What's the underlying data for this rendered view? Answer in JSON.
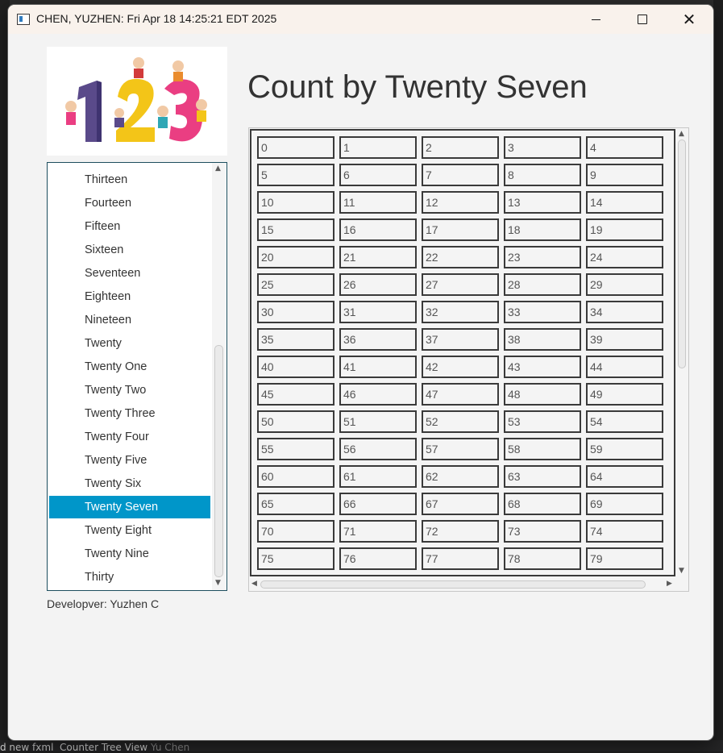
{
  "window": {
    "title": "CHEN, YUZHEN: Fri Apr 18 14:25:21 EDT 2025",
    "controls": {
      "minimize": "–",
      "maximize": "□",
      "close": "✕"
    }
  },
  "heading": "Count by Twenty Seven",
  "developer_label": "Developver: Yuzhen C",
  "list": {
    "items": [
      "Thirteen",
      "Fourteen",
      "Fifteen",
      "Sixteen",
      "Seventeen",
      "Eighteen",
      "Nineteen",
      "Twenty",
      "Twenty One",
      "Twenty Two",
      "Twenty Three",
      "Twenty Four",
      "Twenty Five",
      "Twenty Six",
      "Twenty Seven",
      "Twenty Eight",
      "Twenty Nine",
      "Thirty"
    ],
    "selected": "Twenty Seven"
  },
  "grid": {
    "columns": 5,
    "cells": [
      "0",
      "1",
      "2",
      "3",
      "4",
      "5",
      "6",
      "7",
      "8",
      "9",
      "10",
      "11",
      "12",
      "13",
      "14",
      "15",
      "16",
      "17",
      "18",
      "19",
      "20",
      "21",
      "22",
      "23",
      "24",
      "25",
      "26",
      "27",
      "28",
      "29",
      "30",
      "31",
      "32",
      "33",
      "34",
      "35",
      "36",
      "37",
      "38",
      "39",
      "40",
      "41",
      "42",
      "43",
      "44",
      "45",
      "46",
      "47",
      "48",
      "49",
      "50",
      "51",
      "52",
      "53",
      "54",
      "55",
      "56",
      "57",
      "58",
      "59",
      "60",
      "61",
      "62",
      "63",
      "64",
      "65",
      "66",
      "67",
      "68",
      "69",
      "70",
      "71",
      "72",
      "73",
      "74",
      "75",
      "76",
      "77",
      "78",
      "79"
    ]
  },
  "background": {
    "taskbar_text": "d new fxml",
    "taskbar_text2": "Counter Tree View",
    "taskbar_text3": "Yu Chen"
  },
  "colors": {
    "selection": "#0096c9",
    "list_border": "#1d4e5e",
    "window_bg": "#f3f3f3",
    "titlebar_bg": "#f9f2ec"
  }
}
